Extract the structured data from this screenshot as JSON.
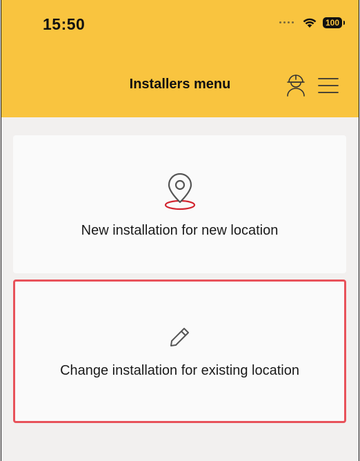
{
  "status_bar": {
    "time": "15:50",
    "battery_level": "100",
    "icons": [
      "signal-dots-icon",
      "wifi-icon",
      "battery-icon"
    ]
  },
  "header": {
    "title": "Installers menu",
    "icons": [
      "installer-profile-icon",
      "hamburger-menu-icon"
    ],
    "background_color": "#f9c43f"
  },
  "options": [
    {
      "label": "New installation for new location",
      "icon": "location-pin-icon",
      "selected": false
    },
    {
      "label": "Change installation for existing location",
      "icon": "pencil-icon",
      "selected": true
    }
  ],
  "colors": {
    "accent": "#f9c43f",
    "selection_border": "#e8525a",
    "pin_ring": "#d2232e",
    "background": "#f2f0ef"
  }
}
